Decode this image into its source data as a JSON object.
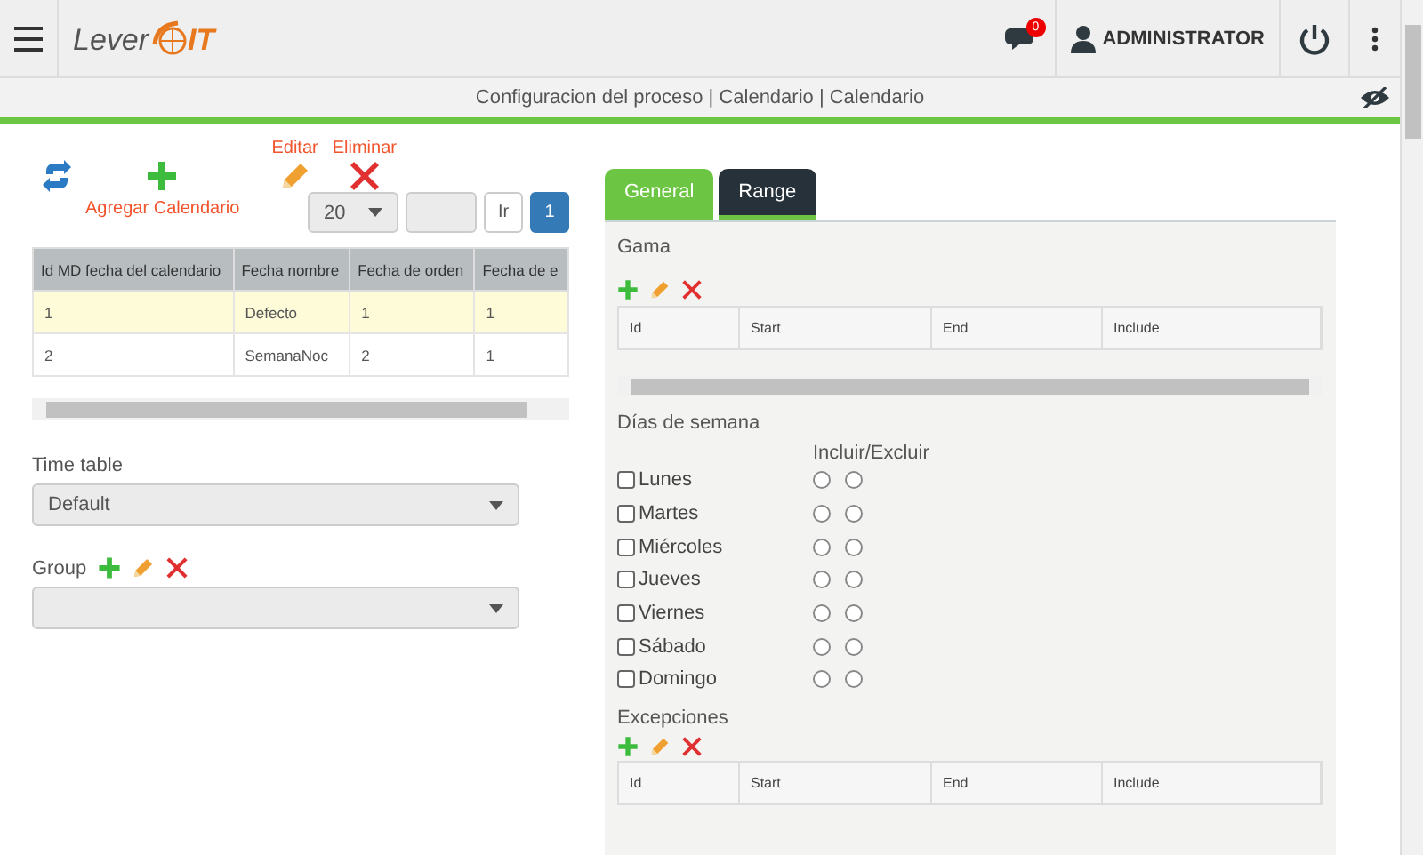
{
  "header": {
    "logo": [
      "Lever",
      "IT"
    ],
    "notifications": "0",
    "user": "ADMINISTRATOR"
  },
  "breadcrumb": "Configuracion del proceso | Calendario | Calendario",
  "toolbar": {
    "edit": "Editar",
    "delete": "Eliminar",
    "add": "Agregar Calendario"
  },
  "pager": {
    "page_size": "20",
    "go": "Ir",
    "pages": [
      {
        "label": "1",
        "selected": true
      }
    ]
  },
  "calendar_table": {
    "columns": [
      "Id MD fecha del calendario",
      "Fecha nombre",
      "Fecha de orden",
      "Fecha de e"
    ],
    "rows": [
      {
        "cells": [
          "1",
          "Defecto",
          "1",
          "1"
        ],
        "selected": true
      },
      {
        "cells": [
          "2",
          "SemanaNoc",
          "2",
          "1"
        ],
        "selected": false
      }
    ]
  },
  "time_table": {
    "label": "Time table",
    "value": "Default"
  },
  "group": {
    "label": "Group"
  },
  "tabs": [
    {
      "label": "General",
      "selected": true
    },
    {
      "label": "Range",
      "selected": false
    }
  ],
  "range": {
    "title": "Gama",
    "columns": [
      "Id",
      "Start",
      "End",
      "Include"
    ]
  },
  "weekdays": {
    "title": "Días de semana",
    "header": "Incluir/Excluir",
    "days": [
      {
        "label": "Lunes",
        "checked": false,
        "options": [
          {
            "selected": false
          },
          {
            "selected": false
          }
        ]
      },
      {
        "label": "Martes",
        "checked": false,
        "options": [
          {
            "selected": false
          },
          {
            "selected": false
          }
        ]
      },
      {
        "label": "Miércoles",
        "checked": false,
        "options": [
          {
            "selected": false
          },
          {
            "selected": false
          }
        ]
      },
      {
        "label": "Jueves",
        "checked": false,
        "options": [
          {
            "selected": false
          },
          {
            "selected": false
          }
        ]
      },
      {
        "label": "Viernes",
        "checked": false,
        "options": [
          {
            "selected": false
          },
          {
            "selected": false
          }
        ]
      },
      {
        "label": "Sábado",
        "checked": false,
        "options": [
          {
            "selected": false
          },
          {
            "selected": false
          }
        ]
      },
      {
        "label": "Domingo",
        "checked": false,
        "options": [
          {
            "selected": false
          },
          {
            "selected": false
          }
        ]
      }
    ]
  },
  "exceptions": {
    "title": "Excepciones",
    "columns": [
      "Id",
      "Start",
      "End",
      "Include"
    ]
  }
}
